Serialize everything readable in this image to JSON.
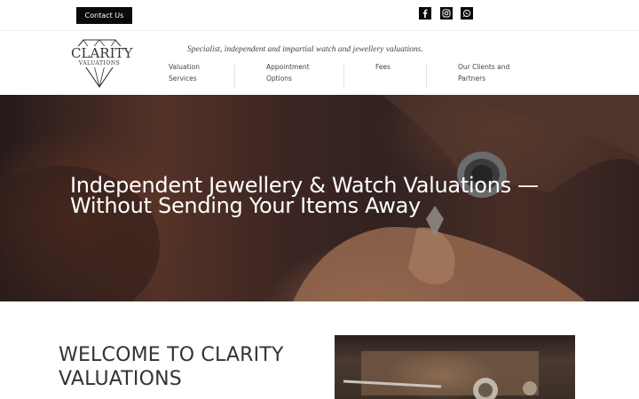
{
  "topbar": {
    "contact_label": "Contact Us",
    "social": [
      {
        "name": "facebook-icon"
      },
      {
        "name": "instagram-icon"
      },
      {
        "name": "whatsapp-icon"
      }
    ]
  },
  "header": {
    "logo": {
      "name": "CLARITY",
      "sub": "VALUATIONS"
    },
    "tagline": "Specialist, independent and impartial watch and jewellery valuations.",
    "nav": [
      {
        "line1": "Valuation",
        "line2": "Services"
      },
      {
        "line1": "Appointment",
        "line2": "Options"
      },
      {
        "line1": "Fees",
        "line2": ""
      },
      {
        "line1": "Our Clients and",
        "line2": "Partners"
      }
    ]
  },
  "hero": {
    "line1": "Independent Jewellery & Watch Valuations —",
    "line2": "Without Sending Your Items Away"
  },
  "welcome": {
    "line1": "WELCOME TO CLARITY",
    "line2": "VALUATIONS"
  },
  "colors": {
    "black": "#0a0a0a",
    "text": "#333333",
    "accent": "#6a4032"
  }
}
